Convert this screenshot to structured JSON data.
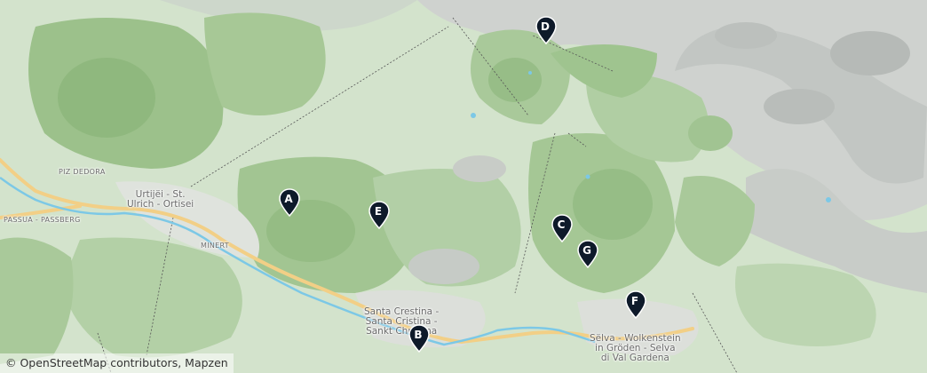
{
  "map": {
    "place_labels": {
      "piz_dedora": "PIZ DEDORA",
      "passua": "PASSUA - PASSBERG",
      "minert": "MINERT",
      "urtijei": "Urtijëi - St.\nUlrich - Ortisei",
      "santa_crestina": "Santa Crestina -\nSanta Cristina -\nSankt Christina",
      "selva": "Sëlva - Wolkenstein\nin Gröden - Selva\ndi Val Gardena"
    },
    "markers": [
      "A",
      "B",
      "C",
      "D",
      "E",
      "F",
      "G"
    ],
    "attribution": "© OpenStreetMap contributors, Mapzen",
    "colors": {
      "marker": "#0e1a2a",
      "forest": "#9fc28f",
      "meadow": "#c9dcc1",
      "rock": "#c4c6c4",
      "river": "#7cc8e6",
      "road": "#f2cf86"
    }
  }
}
